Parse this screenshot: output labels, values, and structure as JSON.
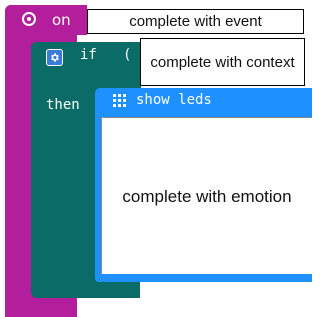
{
  "blocks": {
    "event": {
      "label": "on",
      "icon": "radio-icon",
      "color": "#b21e9b",
      "input_text": "complete with event"
    },
    "if_block": {
      "label": "if",
      "open_paren": "(",
      "then_label": "then",
      "icon": "gear-icon",
      "color": "#0b6b66",
      "input_text": "complete with context"
    },
    "show_leds": {
      "label": "show leds",
      "icon": "led-grid-icon",
      "color": "#1e90ff",
      "body_text": "complete with emotion"
    }
  }
}
